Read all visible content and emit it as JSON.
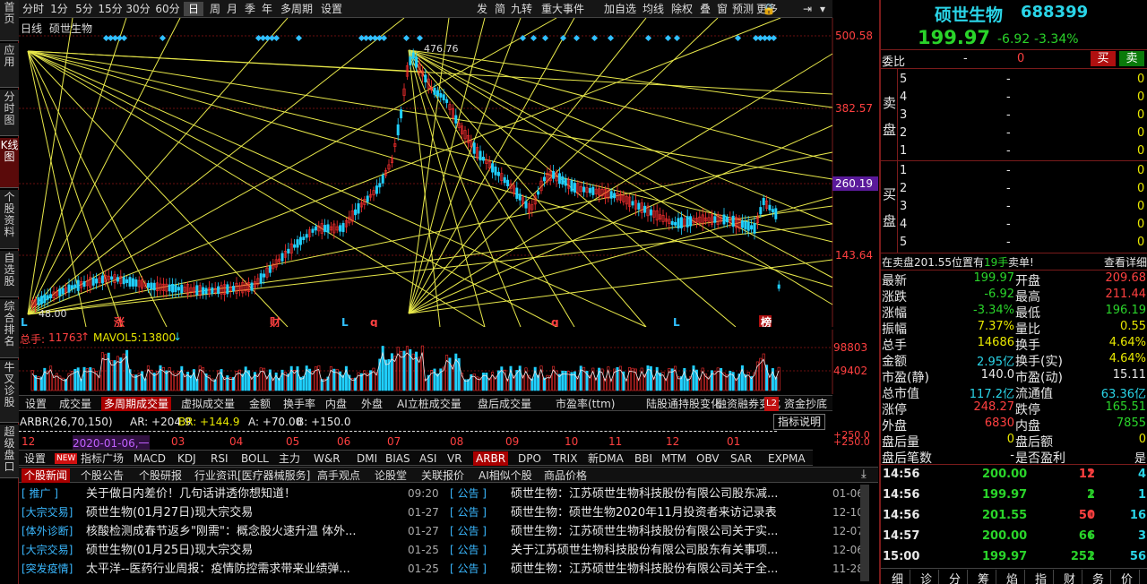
{
  "left_tabs": [
    "首页",
    "应用",
    "分时图",
    "K线图",
    "个股资料",
    "自选股",
    "综合排名",
    "牛叉诊股",
    "超级盘口"
  ],
  "period_tabs": [
    "分时",
    "1分",
    "5分",
    "15分",
    "30分",
    "60分",
    "日",
    "周",
    "月",
    "季",
    "年",
    "多周期",
    "设置"
  ],
  "tool_tabs": [
    "发",
    "简",
    "九转",
    "重大事件",
    "加自选",
    "均线",
    "除权",
    "叠",
    "窗",
    "预测",
    "更多"
  ],
  "chart": {
    "title": "日线",
    "stock": "硕世生物",
    "high_label": "476.76",
    "low_label": "48.00",
    "price_ticks": [
      "500.58",
      "382.57",
      "260.19",
      "143.64"
    ],
    "highlight_price": "260.19",
    "markers": [
      "L",
      "涨",
      "财",
      "L",
      "q",
      "q",
      "L",
      "榜"
    ]
  },
  "vol": {
    "label": "总手:",
    "value": "11763",
    "ma_label": "MAVOL5:",
    "ma_value": "13800",
    "ticks": [
      "98803",
      "49402"
    ]
  },
  "indicator_tabs_1": [
    "设置",
    "成交量",
    "多周期成交量",
    "虚拟成交量",
    "金额",
    "换手率",
    "内盘",
    "外盘",
    "AI立桩成交量",
    "盘后成交量",
    "市盈率(ttm)",
    "陆股通持股变化",
    "融资融券变化",
    "资金抄底"
  ],
  "arbr": {
    "name": "ARBR(26,70,150)",
    "ar": "AR: +204.9",
    "br": "BR: +144.9",
    "a": "A: +70.00",
    "b": "B: +150.0",
    "btn": "指标说明"
  },
  "date_axis": [
    "12",
    "2020-01-06,一",
    "03",
    "04",
    "05",
    "06",
    "07",
    "08",
    "09",
    "10",
    "11",
    "12",
    "01"
  ],
  "date_right_ticks": [
    "+250.0",
    "+250.0"
  ],
  "indicator_tabs_2": [
    "设置",
    "NEW",
    "指标广场",
    "MACD",
    "KDJ",
    "RSI",
    "BOLL",
    "主力",
    "W&R",
    "DMI",
    "BIAS",
    "ASI",
    "VR",
    "ARBR",
    "DPO",
    "TRIX",
    "新DMA",
    "BBI",
    "MTM",
    "OBV",
    "SAR",
    "EXPMA"
  ],
  "news_tabs": [
    "个股新闻",
    "个股公告",
    "个股研报",
    "行业资讯[医疗器械服务]",
    "高手观点",
    "论股堂",
    "关联报价",
    "AI相似个股",
    "商品价格"
  ],
  "news": [
    {
      "tag": "[  推广  ]",
      "title": "关于做日内差价！几句话讲透你想知道！",
      "date": "09:20"
    },
    {
      "tag": "[大宗交易]",
      "title": "硕世生物(01月27日)现大宗交易",
      "date": "01-27"
    },
    {
      "tag": "[体外诊断]",
      "title": "核酸检测成春节返乡\"刚需\"：概念股火速升温 体外...",
      "date": "01-27"
    },
    {
      "tag": "[大宗交易]",
      "title": "硕世生物(01月25日)现大宗交易",
      "date": "01-25"
    },
    {
      "tag": "[突发疫情]",
      "title": "太平洋--医药行业周报：疫情防控需求带来业绩弹...",
      "date": "01-25"
    }
  ],
  "notices": [
    {
      "tag": "[  公告  ]",
      "title": "硕世生物：江苏硕世生物科技股份有限公司股东减...",
      "date": "01-06"
    },
    {
      "tag": "[  公告  ]",
      "title": "硕世生物：硕世生物2020年11月投资者来访记录表",
      "date": "12-10"
    },
    {
      "tag": "[  公告  ]",
      "title": "硕世生物：江苏硕世生物科技股份有限公司关于实...",
      "date": "12-07"
    },
    {
      "tag": "[  公告  ]",
      "title": "关于江苏硕世生物科技股份有限公司股东有关事项...",
      "date": "12-06"
    },
    {
      "tag": "[  公告  ]",
      "title": "硕世生物：江苏硕世生物科技股份有限公司关于全...",
      "date": "11-28"
    }
  ],
  "quote": {
    "name": "硕世生物",
    "code": "688399",
    "price": "199.97",
    "change": "-6.92",
    "pct": "-3.34%"
  },
  "order": {
    "wb_label": "委比",
    "wb_value": "-",
    "wb_num": "0",
    "buy": "买",
    "sell": "卖",
    "ask_label": "卖盘",
    "bid_label": "买盘",
    "asks": [
      {
        "lvl": "5",
        "p": "-",
        "v": "0"
      },
      {
        "lvl": "4",
        "p": "-",
        "v": "0"
      },
      {
        "lvl": "3",
        "p": "-",
        "v": "0"
      },
      {
        "lvl": "2",
        "p": "-",
        "v": "0"
      },
      {
        "lvl": "1",
        "p": "-",
        "v": "0"
      }
    ],
    "bids": [
      {
        "lvl": "1",
        "p": "-",
        "v": "0"
      },
      {
        "lvl": "2",
        "p": "-",
        "v": "0"
      },
      {
        "lvl": "3",
        "p": "-",
        "v": "0"
      },
      {
        "lvl": "4",
        "p": "-",
        "v": "0"
      },
      {
        "lvl": "5",
        "p": "-",
        "v": "0"
      }
    ]
  },
  "notice_bar": {
    "prefix": "在卖盘201.55位置有",
    "qty": "19手",
    "suffix": "卖单!",
    "link": "查看详细"
  },
  "stats": [
    {
      "l1": "最新",
      "v1": "199.97",
      "c1": "grn",
      "l2": "开盘",
      "v2": "209.68",
      "c2": "red"
    },
    {
      "l1": "涨跌",
      "v1": "-6.92",
      "c1": "grn",
      "l2": "最高",
      "v2": "211.44",
      "c2": "red"
    },
    {
      "l1": "涨幅",
      "v1": "-3.34%",
      "c1": "grn",
      "l2": "最低",
      "v2": "196.19",
      "c2": "grn"
    },
    {
      "l1": "振幅",
      "v1": "7.37%",
      "c1": "yel",
      "l2": "量比",
      "v2": "0.55",
      "c2": "yel"
    },
    {
      "l1": "总手",
      "v1": "14686",
      "c1": "yel",
      "l2": "换手",
      "v2": "4.64%",
      "c2": "yel"
    },
    {
      "l1": "金额",
      "v1": "2.95亿",
      "c1": "cyn",
      "l2": "换手(实)",
      "v2": "4.64%",
      "c2": "yel"
    },
    {
      "l1": "市盈(静)",
      "v1": "140.0",
      "c1": "wht",
      "l2": "市盈(动)",
      "v2": "15.11",
      "c2": "wht"
    },
    {
      "l1": "总市值",
      "v1": "117.2亿",
      "c1": "cyn",
      "l2": "流通值",
      "v2": "63.36亿",
      "c2": "cyn"
    },
    {
      "l1": "涨停",
      "v1": "248.27",
      "c1": "red",
      "l2": "跌停",
      "v2": "165.51",
      "c2": "grn"
    },
    {
      "l1": "外盘",
      "v1": "6830",
      "c1": "red",
      "l2": "内盘",
      "v2": "7855",
      "c2": "grn"
    },
    {
      "l1": "盘后量",
      "v1": "0",
      "c1": "yel",
      "l2": "盘后额",
      "v2": "0",
      "c2": "yel"
    },
    {
      "l1": "盘后笔数",
      "v1": "-",
      "c1": "wht",
      "l2": "是否盈利",
      "v2": "是",
      "c2": "wht"
    }
  ],
  "ticks": [
    {
      "t": "14:56",
      "p": "200.00",
      "v": "12",
      "dir": "up",
      "n": "4"
    },
    {
      "t": "14:56",
      "p": "199.97",
      "v": "2",
      "dir": "down",
      "n": "1"
    },
    {
      "t": "14:56",
      "p": "201.55",
      "v": "50",
      "dir": "up",
      "n": "16"
    },
    {
      "t": "14:57",
      "p": "200.00",
      "v": "66",
      "dir": "down",
      "n": "3"
    },
    {
      "t": "15:00",
      "p": "199.97",
      "v": "252",
      "dir": "down",
      "n": "56"
    }
  ],
  "bottom_tabs": [
    "细",
    "诊",
    "分",
    "筹",
    "焰",
    "指",
    "财",
    "务",
    "价"
  ]
}
